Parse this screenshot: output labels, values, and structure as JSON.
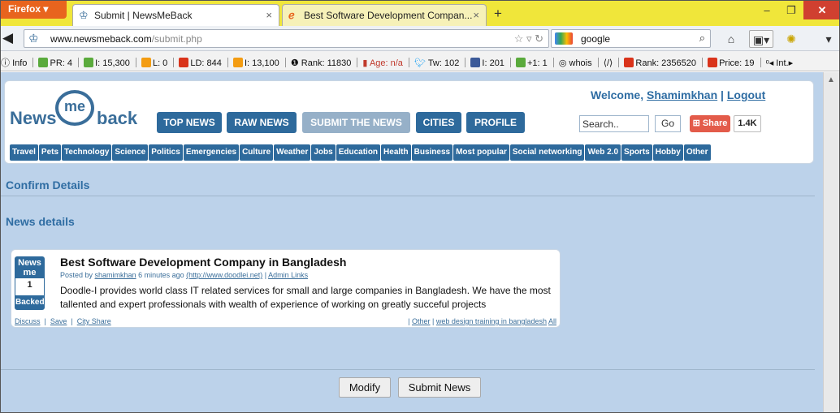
{
  "browser": {
    "menu_label": "Firefox",
    "tabs": [
      {
        "title": "Submit | NewsMeBack"
      },
      {
        "title": "Best Software Development Compan..."
      }
    ],
    "new_tab": "+",
    "url_host": "www.newsmeback.com",
    "url_path": "/submit.php",
    "search_value": "google"
  },
  "infobar": {
    "info": "Info",
    "pr": "PR: 4",
    "i1": "I: 15,300",
    "l": "L: 0",
    "ld": "LD: 844",
    "i2": "I: 13,100",
    "rank": "Rank: 11830",
    "age": "Age: n/a",
    "tw": "Tw: 102",
    "fb": "I: 201",
    "gplus": "+1: 1",
    "whois": "whois",
    "rank2": "Rank: 2356520",
    "price": "Price: 19",
    "int": "Int.",
    "colors": {
      "seo_green": "#5aaa3c",
      "seo_orange": "#f39c12",
      "rank_red": "#d9331a"
    }
  },
  "site": {
    "logo_news": "News",
    "logo_me": "me",
    "logo_back": "back",
    "welcome_prefix": "Welcome,",
    "username": "Shamimkhan",
    "separator": "|",
    "logout": "Logout",
    "nav": [
      "TOP NEWS",
      "RAW NEWS",
      "SUBMIT THE NEWS",
      "CITIES",
      "PROFILE"
    ],
    "search_placeholder": "Search..",
    "go": "Go",
    "share": "Share",
    "share_count": "1.4K",
    "categories": [
      "Travel",
      "Pets",
      "Technology",
      "Science",
      "Politics",
      "Emergencies",
      "Culture",
      "Weather",
      "Jobs",
      "Education",
      "Health",
      "Business",
      "Most popular",
      "Social networking",
      "Web 2.0",
      "Sports",
      "Hobby",
      "Other"
    ],
    "accent": "#2e6a9c",
    "bg": "#bcd2ea"
  },
  "page": {
    "confirm_title": "Confirm Details",
    "news_details_title": "News details"
  },
  "story": {
    "badge_top1": "News",
    "badge_top2": "me",
    "badge_count": "1",
    "badge_bottom": "Backed",
    "title": "Best Software Development Company in Bangladesh",
    "posted_by": "Posted by",
    "author": "shamimkhan",
    "time": "6 minutes ago",
    "source_url": "(http://www.doodlei.net)",
    "admin_links": "Admin Links",
    "text": "Doodle-I provides world class IT related services for small and large companies in Bangladesh. We have the most tallented and expert professionals with wealth of experience of working on greatly succeful projects",
    "discuss": "Discuss",
    "save": "Save",
    "city_share": "City Share",
    "tag_other": "Other",
    "tag_training": "web design training in bangladesh",
    "tag_all": "All"
  },
  "actions": {
    "modify": "Modify",
    "submit": "Submit News"
  }
}
